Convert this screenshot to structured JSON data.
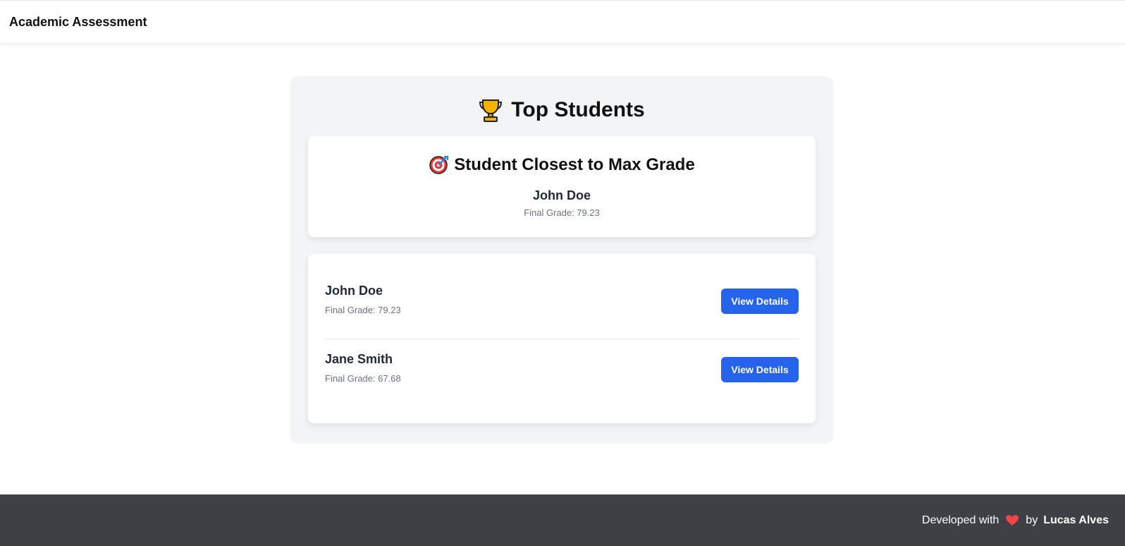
{
  "navbar": {
    "brand": "Academic Assessment"
  },
  "panel": {
    "title": "Top Students",
    "title_icon": "trophy-icon"
  },
  "closest": {
    "title": "Student Closest to Max Grade",
    "title_icon": "target-icon",
    "name": "John Doe",
    "grade_text": "Final Grade: 79.23"
  },
  "students": [
    {
      "name": "John Doe",
      "grade_text": "Final Grade: 79.23",
      "button_label": "View Details"
    },
    {
      "name": "Jane Smith",
      "grade_text": "Final Grade: 67.68",
      "button_label": "View Details"
    }
  ],
  "footer": {
    "prefix": "Developed with",
    "heart_icon": "heart-icon",
    "by": "by",
    "author": "Lucas Alves"
  },
  "colors": {
    "accent": "#2563eb",
    "footer_bg": "#3f4045",
    "panel_bg": "#f3f4f6",
    "heart": "#ef4444",
    "trophy": "#f5b301"
  }
}
